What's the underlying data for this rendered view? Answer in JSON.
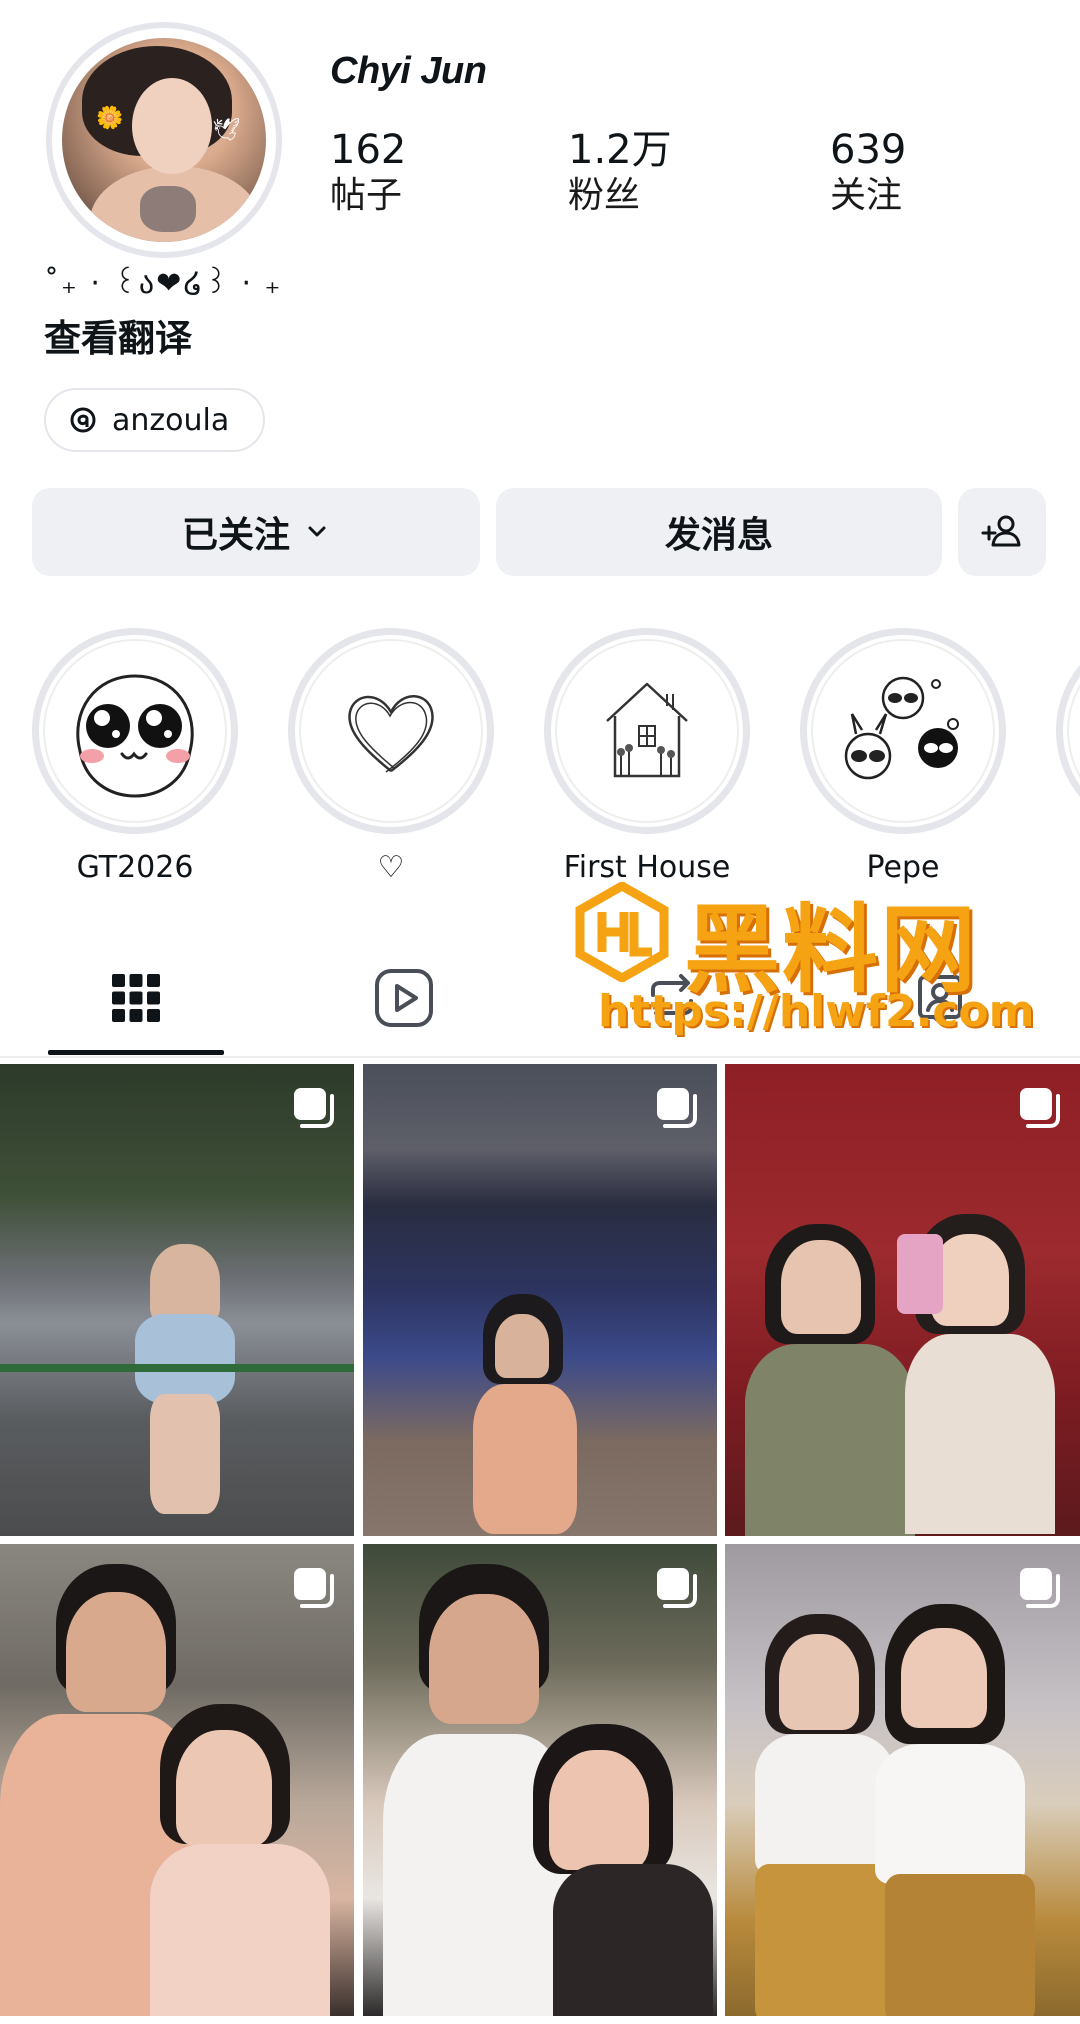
{
  "profile": {
    "display_name": "Chyi Jun",
    "bio": "˚₊ · ꒰ა❤໒꒱ · ₊",
    "translate_link": "查看翻译",
    "threads_handle": "anzoula",
    "stats": {
      "posts": {
        "value": "162",
        "label": "帖子"
      },
      "followers": {
        "value": "1.2万",
        "label": "粉丝"
      },
      "following": {
        "value": "639",
        "label": "关注"
      }
    }
  },
  "actions": {
    "following_label": "已关注",
    "message_label": "发消息",
    "add_user_icon": "person-plus-icon"
  },
  "highlights": [
    {
      "label": "GT2026",
      "icon": "cute-face-sticker"
    },
    {
      "label": "♡",
      "icon": "heart-doodle"
    },
    {
      "label": "First House",
      "icon": "house-doodle"
    },
    {
      "label": "Pepe",
      "icon": "powerpuff-doodle"
    },
    {
      "label": "",
      "icon": "partial-highlight"
    }
  ],
  "tabs": [
    {
      "name": "grid",
      "icon": "grid-icon",
      "active": true
    },
    {
      "name": "reels",
      "icon": "reels-icon",
      "active": false
    },
    {
      "name": "reposts",
      "icon": "repost-icon",
      "active": false
    },
    {
      "name": "tagged",
      "icon": "tagged-icon",
      "active": false
    }
  ],
  "watermark": {
    "brand": "黑料网",
    "url": "https://hlwf2.com",
    "color": "#f6a313"
  },
  "posts": [
    {
      "type": "carousel",
      "scene": "street-railing-night"
    },
    {
      "type": "carousel",
      "scene": "rooftop-pool-city-night"
    },
    {
      "type": "carousel",
      "scene": "mirror-selfie-red-wall"
    },
    {
      "type": "carousel",
      "scene": "couple-cave"
    },
    {
      "type": "carousel",
      "scene": "couple-selfie-night"
    },
    {
      "type": "carousel",
      "scene": "two-girls-plaid-skirts"
    }
  ],
  "colors": {
    "button_bg": "#eff0f3",
    "ring": "#e4e6eb",
    "text": "#0f1419"
  }
}
